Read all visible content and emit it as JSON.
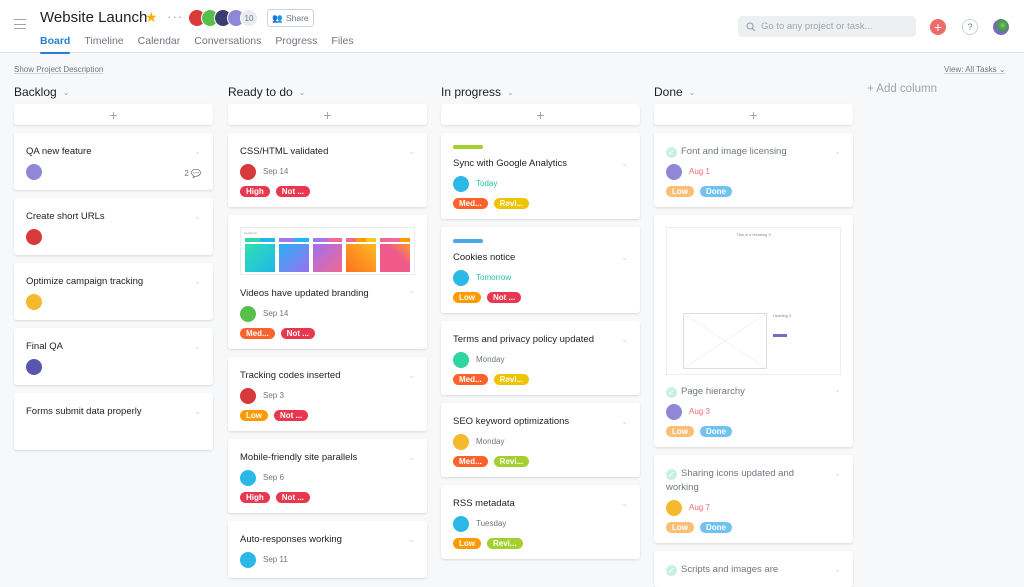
{
  "header": {
    "title": "Website Launch",
    "member_count": "10",
    "share_label": "Share",
    "tabs": [
      "Board",
      "Timeline",
      "Calendar",
      "Conversations",
      "Progress",
      "Files"
    ],
    "active_tab": "Board",
    "search_placeholder": "Go to any project or task...",
    "icons": {
      "menu": "hamburger-icon",
      "favorite": "star-icon",
      "more": "ellipsis-icon",
      "add": "plus-icon",
      "help": "question-icon",
      "search": "search-icon"
    }
  },
  "toolbar": {
    "show_description": "Show Project Description",
    "view_filter": "View: All Tasks",
    "add_column": "+ Add column"
  },
  "colors": {
    "accent": "#2a7ed3",
    "high": "#e8384f",
    "medium": "#fd612c",
    "low": "#fd9a00",
    "review_yellow": "#eec300",
    "review_green": "#a4cf30",
    "done_blue": "#6fc3ee",
    "stripe_green": "#a4cf30",
    "stripe_blue": "#4aa8e8"
  },
  "columns": [
    {
      "title": "Backlog",
      "cards": [
        {
          "name": "QA new feature",
          "comments": "2"
        },
        {
          "name": "Create short URLs"
        },
        {
          "name": "Optimize campaign tracking"
        },
        {
          "name": "Final QA"
        },
        {
          "name": "Forms submit data properly"
        }
      ]
    },
    {
      "title": "Ready to do",
      "cards": [
        {
          "name": "CSS/HTML validated",
          "date": "Sep 14",
          "tags": [
            "High",
            "Not ..."
          ]
        },
        {
          "name": "Videos have updated branding",
          "date": "Sep 14",
          "tags": [
            "Med...",
            "Not ..."
          ],
          "thumb_label": "Gradients"
        },
        {
          "name": "Tracking codes inserted",
          "date": "Sep 3",
          "tags": [
            "Low",
            "Not ..."
          ]
        },
        {
          "name": "Mobile-friendly site parallels",
          "date": "Sep 6",
          "tags": [
            "High",
            "Not ..."
          ]
        },
        {
          "name": "Auto-responses working",
          "date": "Sep 11"
        }
      ]
    },
    {
      "title": "In progress",
      "cards": [
        {
          "name": "Sync with Google Analytics",
          "date": "Today",
          "tags": [
            "Med...",
            "Revi..."
          ]
        },
        {
          "name": "Cookies notice",
          "date": "Tomorrow",
          "tags": [
            "Low",
            "Not ..."
          ]
        },
        {
          "name": "Terms and privacy policy updated",
          "date": "Monday",
          "tags": [
            "Med...",
            "Revi..."
          ]
        },
        {
          "name": "SEO keyword optimizations",
          "date": "Monday",
          "tags": [
            "Med...",
            "Revi..."
          ]
        },
        {
          "name": "RSS metadata",
          "date": "Tuesday",
          "tags": [
            "Low",
            "Revi..."
          ]
        }
      ]
    },
    {
      "title": "Done",
      "cards": [
        {
          "name": "Font and image licensing",
          "date": "Aug 1",
          "tags": [
            "Low",
            "Done"
          ]
        },
        {
          "name": "Page hierarchy",
          "date": "Aug 3",
          "tags": [
            "Low",
            "Done"
          ],
          "thumb_heading": "This is a Heading 3",
          "thumb_heading2": "Heading 3"
        },
        {
          "name": "Sharing icons updated and working",
          "date": "Aug 7",
          "tags": [
            "Low",
            "Done"
          ]
        },
        {
          "name": "Scripts and images are"
        }
      ]
    }
  ]
}
